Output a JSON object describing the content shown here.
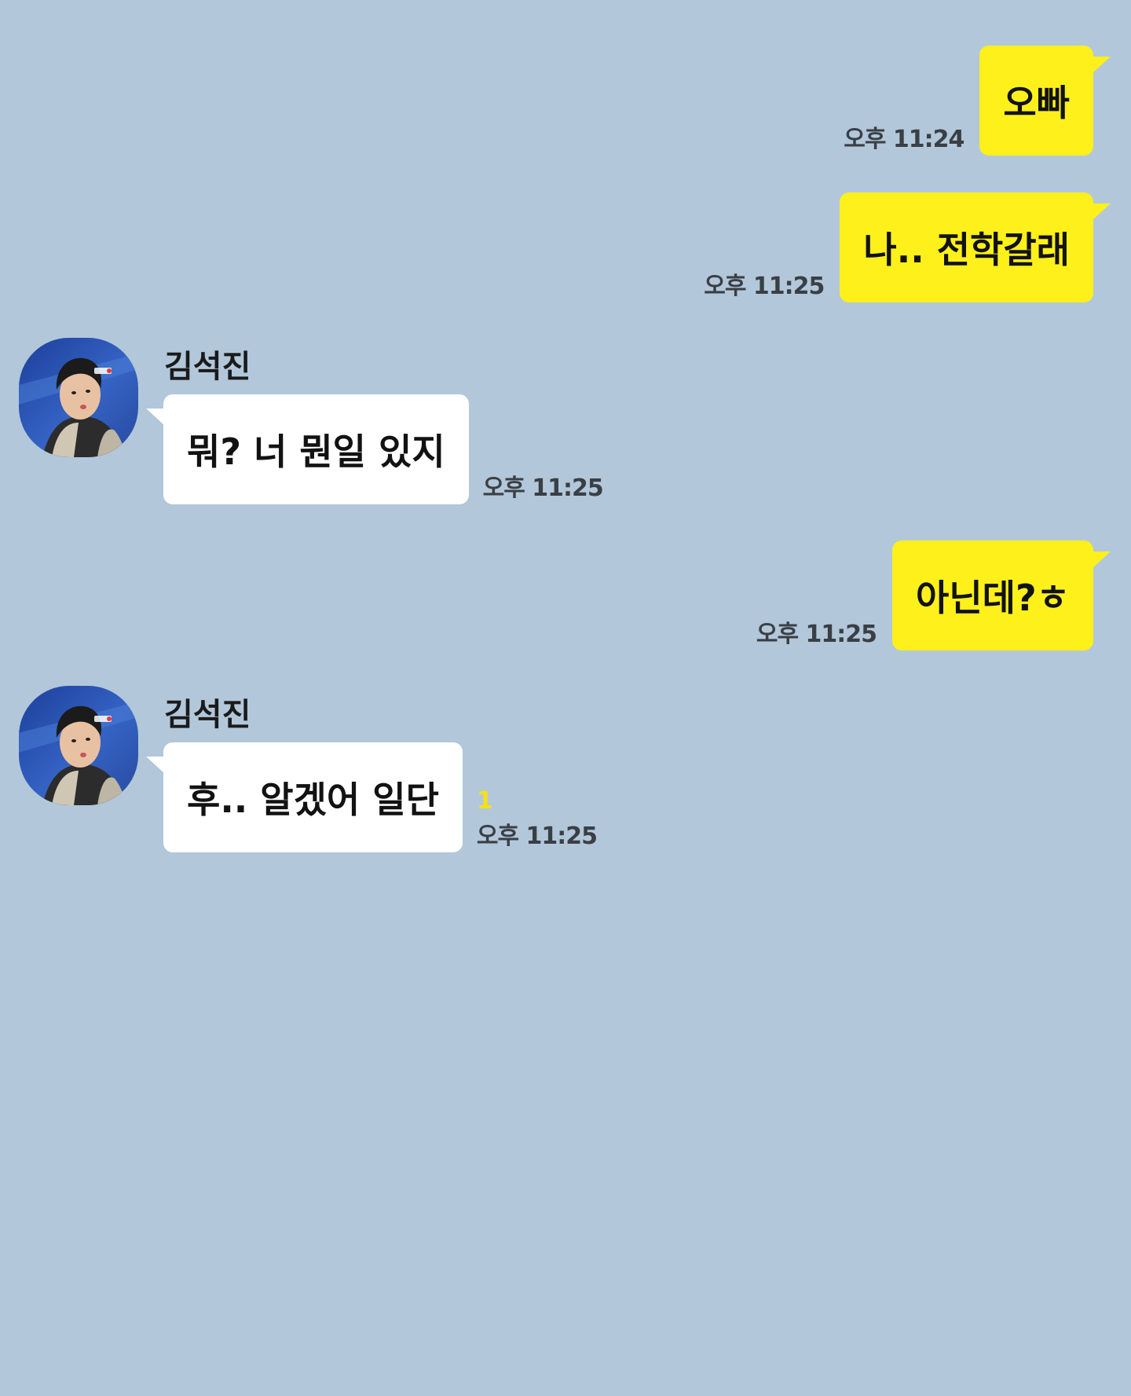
{
  "colors": {
    "background": "#b2c7da",
    "outgoing_bubble": "#fef01b",
    "incoming_bubble": "#ffffff",
    "unread_count": "#f4e01b"
  },
  "messages": [
    {
      "direction": "outgoing",
      "text": "오빠",
      "time": "오후 11:24"
    },
    {
      "direction": "outgoing",
      "text": "나.. 전학갈래",
      "time": "오후 11:25"
    },
    {
      "direction": "incoming",
      "sender": "김석진",
      "avatar_icon": "profile-photo",
      "text": "뭐? 너 뭔일 있지",
      "time": "오후 11:25"
    },
    {
      "direction": "outgoing",
      "text": "아닌데?ㅎ",
      "time": "오후 11:25"
    },
    {
      "direction": "incoming",
      "sender": "김석진",
      "avatar_icon": "profile-photo",
      "text": "후..  알겠어 일단",
      "unread": "1",
      "time": "오후 11:25"
    }
  ]
}
